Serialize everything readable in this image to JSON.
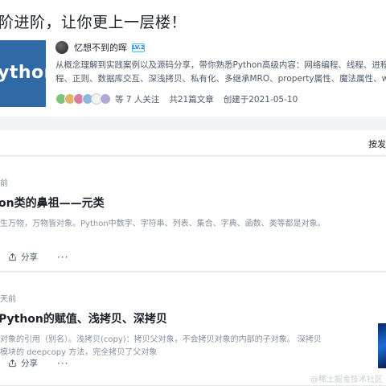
{
  "column": {
    "title": "阶进阶，让你更上一层楼！",
    "cover_text": "ython",
    "author": {
      "name": "忆想不到的晖",
      "level": "LV.2"
    },
    "description": [
      "从概念理解到实践案例以及源码分享，带你熟悉Python高级内容：网络编程、线程、进程、装",
      "程、正则、数据库交互、深浅拷贝、私有化、多继承MRO、property属性、魔法属性、with"
    ],
    "followers_text": "等 7 人关注",
    "article_count": "共21篇文章",
    "created": "创建于2021-05-10"
  },
  "sort": {
    "label": "按发"
  },
  "articles": [
    {
      "time": "前",
      "title": "on类的鼻祖——元类",
      "abstract": "生万物，万物皆对象。Python中数字、字符串、列表、集合、字典、函数、类等都是对象。",
      "share": "分享",
      "more": "···"
    },
    {
      "time": "天前",
      "title": "Python的赋值、浅拷贝、深拷贝",
      "abstract": [
        "对象的引用（别名）。浅拷贝(copy)：拷贝父对象，不会拷贝对象的内部的子对象。 深拷贝",
        "模块的 deepcopy 方法，完全拷贝了父对象"
      ],
      "share": "分享",
      "more": "···"
    }
  ],
  "watermark": "@稀土掘金技术社区",
  "colors": {
    "accent": "#1e80ff",
    "cover": "#2f6aa7",
    "text_secondary": "#86909c"
  }
}
